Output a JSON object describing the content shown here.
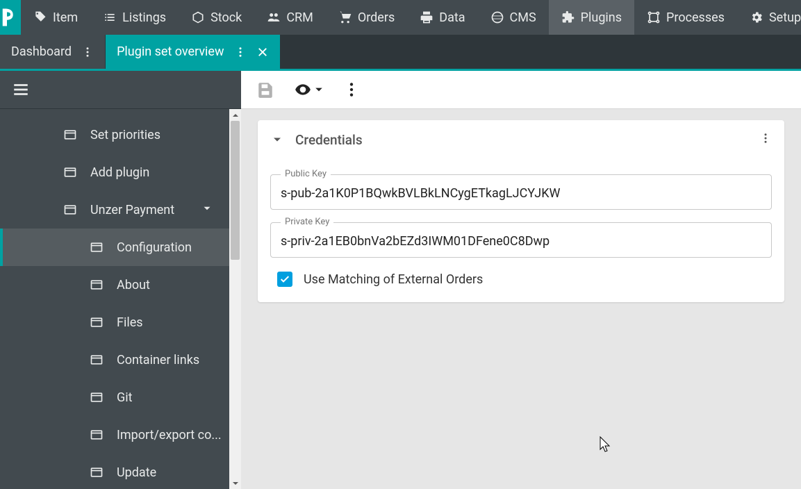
{
  "topnav": {
    "items": [
      {
        "label": "Item"
      },
      {
        "label": "Listings"
      },
      {
        "label": "Stock"
      },
      {
        "label": "CRM"
      },
      {
        "label": "Orders"
      },
      {
        "label": "Data"
      },
      {
        "label": "CMS"
      },
      {
        "label": "Plugins"
      },
      {
        "label": "Processes"
      },
      {
        "label": "Setup"
      }
    ]
  },
  "tabs": {
    "dashboard": "Dashboard",
    "plugin_overview": "Plugin set overview"
  },
  "sidebar": {
    "items": [
      {
        "label": "Set priorities"
      },
      {
        "label": "Add plugin"
      },
      {
        "label": "Unzer Payment"
      },
      {
        "label": "Configuration"
      },
      {
        "label": "About"
      },
      {
        "label": "Files"
      },
      {
        "label": "Container links"
      },
      {
        "label": "Git"
      },
      {
        "label": "Import/export co..."
      },
      {
        "label": "Update"
      }
    ]
  },
  "card": {
    "title": "Credentials",
    "public_key_label": "Public Key",
    "public_key_value": "s-pub-2a1K0P1BQwkBVLBkLNCygETkagLJCYJKW",
    "private_key_label": "Private Key",
    "private_key_value": "s-priv-2a1EB0bnVa2bEZd3IWM01DFene0C8Dwp",
    "checkbox_label": "Use Matching of External Orders",
    "checkbox_checked": true
  }
}
